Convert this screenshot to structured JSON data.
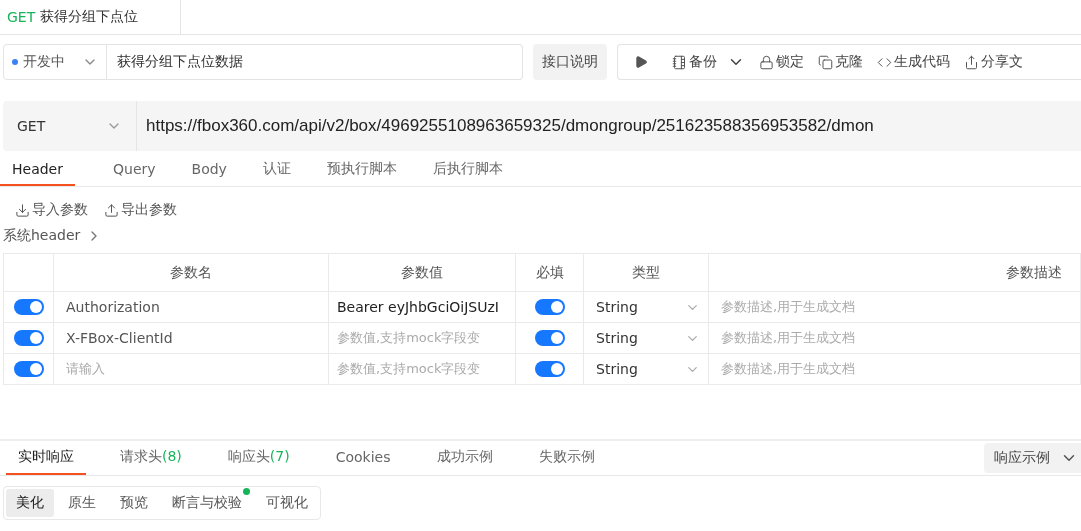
{
  "doc_tab": {
    "method": "GET",
    "title": "获得分组下点位"
  },
  "toolbar": {
    "status": {
      "label": "开发中",
      "color": "#3b82f6"
    },
    "name": "获得分组下点位数据",
    "doc_button": "接口说明",
    "actions": [
      {
        "kind": "backup",
        "label": "备份"
      },
      {
        "kind": "lock",
        "label": "锁定"
      },
      {
        "kind": "clone",
        "label": "克隆"
      },
      {
        "kind": "code",
        "label": "生成代码"
      },
      {
        "kind": "share",
        "label": "分享文"
      }
    ]
  },
  "request": {
    "method": "GET",
    "url": "https://fbox360.com/api/v2/box/4969255108963659325/dmongroup/251623588356953582/dmon"
  },
  "param_tabs": [
    {
      "label": "Header",
      "selected": true
    },
    {
      "label": "Query",
      "selected": false
    },
    {
      "label": "Body",
      "selected": false
    },
    {
      "label": "认证",
      "selected": false
    },
    {
      "label": "预执行脚本",
      "selected": false
    },
    {
      "label": "后执行脚本",
      "selected": false
    }
  ],
  "param_actions": [
    {
      "kind": "import",
      "label": "导入参数"
    },
    {
      "kind": "export",
      "label": "导出参数"
    }
  ],
  "system_header": "系统header",
  "table": {
    "columns": [
      "参数名",
      "参数值",
      "必填",
      "类型",
      "参数描述"
    ],
    "rows": [
      {
        "on": true,
        "name": "Authorization",
        "value": "Bearer eyJhbGciOiJSUzI",
        "required": true,
        "type": "String",
        "description_placeholder": "参数描述,用于生成文档"
      },
      {
        "on": true,
        "name": "X-FBox-ClientId",
        "value_placeholder": "参数值,支持mock字段变",
        "required": true,
        "type": "String",
        "description_placeholder": "参数描述,用于生成文档"
      },
      {
        "on": true,
        "name_placeholder": "请输入",
        "value_placeholder": "参数值,支持mock字段变",
        "required": true,
        "type": "String",
        "description_placeholder": "参数描述,用于生成文档"
      }
    ]
  },
  "response_tabs": [
    {
      "label": "实时响应",
      "selected": true
    },
    {
      "label": "请求头",
      "count": "(8)",
      "selected": false
    },
    {
      "label": "响应头",
      "count": "(7)",
      "selected": false
    },
    {
      "label": "Cookies",
      "selected": false
    },
    {
      "label": "成功示例",
      "selected": false
    },
    {
      "label": "失败示例",
      "selected": false
    }
  ],
  "response_example": "响应示例",
  "view_modes": [
    {
      "label": "美化",
      "selected": true,
      "dot": false
    },
    {
      "label": "原生",
      "selected": false,
      "dot": false
    },
    {
      "label": "预览",
      "selected": false,
      "dot": false
    },
    {
      "label": "断言与校验",
      "selected": false,
      "dot": true
    },
    {
      "label": "可视化",
      "selected": false,
      "dot": false
    }
  ]
}
